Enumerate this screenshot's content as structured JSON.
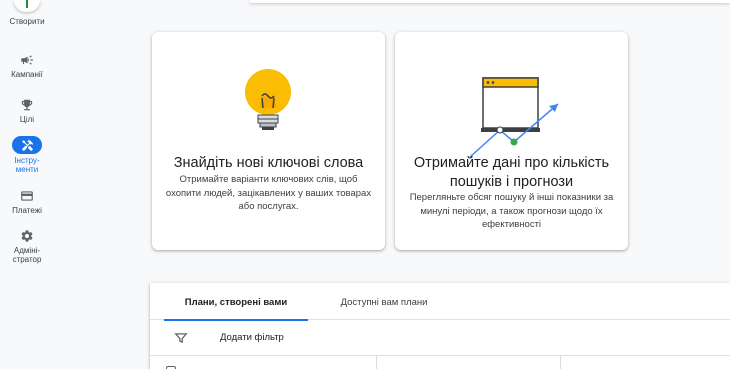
{
  "nav": {
    "create_label": "Створити",
    "items": [
      {
        "label": "Кампанії",
        "icon": "megaphone-icon"
      },
      {
        "label": "Цілі",
        "icon": "trophy-icon"
      },
      {
        "label_line1": "Інстру-",
        "label_line2": "менти",
        "icon": "tools-icon"
      },
      {
        "label": "Платежі",
        "icon": "credit-card-icon"
      },
      {
        "label_line1": "Адміні-",
        "label_line2": "стратор",
        "icon": "gear-icon"
      }
    ],
    "active_color": "#1a73e8"
  },
  "cards": [
    {
      "title": "Знайдіть нові ключові слова",
      "description": "Отримайте варіанти ключових слів, щоб охопити людей, зацікавлених у ваших товарах або послугах.",
      "illustration": "lightbulb-icon"
    },
    {
      "title": "Отримайте дані про кількість пошуків і прогнози",
      "description": "Перегляньте обсяг пошуку й інші показники за минулі періоди, а також прогнози щодо їх ефективності",
      "illustration": "trend-chart-icon"
    }
  ],
  "plans": {
    "tabs": [
      "Плани, створені вами",
      "Доступні вам плани"
    ],
    "filter_label": "Додати фільтр"
  }
}
